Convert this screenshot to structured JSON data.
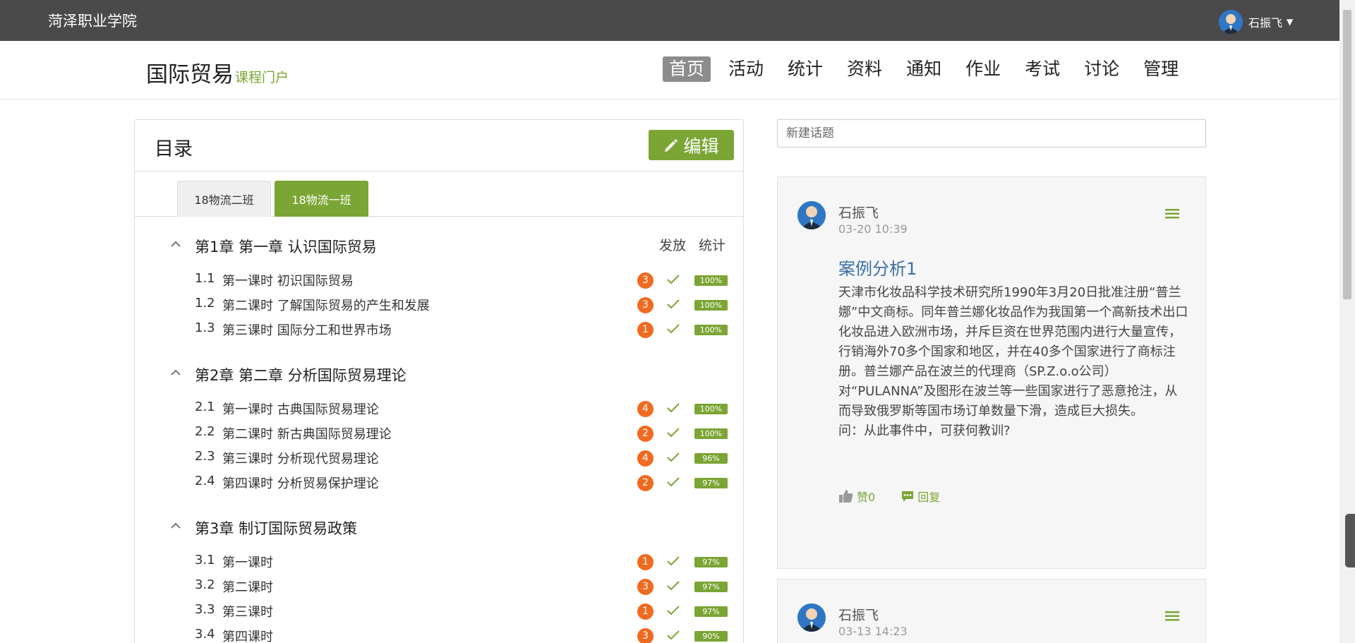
{
  "topbar": {
    "school": "菏泽职业学院",
    "user_name": "石振飞"
  },
  "header": {
    "course_title": "国际贸易",
    "course_subtitle": "课程门户",
    "menu": [
      {
        "label": "首页",
        "active": true
      },
      {
        "label": "活动"
      },
      {
        "label": "统计"
      },
      {
        "label": "资料"
      },
      {
        "label": "通知"
      },
      {
        "label": "作业"
      },
      {
        "label": "考试"
      },
      {
        "label": "讨论"
      },
      {
        "label": "管理"
      }
    ]
  },
  "catalog": {
    "title": "目录",
    "edit_label": "编辑",
    "tabs": [
      {
        "label": "18物流二班"
      },
      {
        "label": "18物流一班",
        "active": true
      }
    ],
    "col_release": "发放",
    "col_stats": "统计",
    "chapters": [
      {
        "title": "第1章 第一章 认识国际贸易",
        "lessons": [
          {
            "num": "1.1",
            "title": "第一课时 初识国际贸易",
            "badge": "3",
            "pct": "100%"
          },
          {
            "num": "1.2",
            "title": "第二课时 了解国际贸易的产生和发展",
            "badge": "3",
            "pct": "100%"
          },
          {
            "num": "1.3",
            "title": "第三课时 国际分工和世界市场",
            "badge": "1",
            "pct": "100%"
          }
        ]
      },
      {
        "title": "第2章 第二章 分析国际贸易理论",
        "lessons": [
          {
            "num": "2.1",
            "title": "第一课时 古典国际贸易理论",
            "badge": "4",
            "pct": "100%"
          },
          {
            "num": "2.2",
            "title": "第二课时 新古典国际贸易理论",
            "badge": "2",
            "pct": "100%"
          },
          {
            "num": "2.3",
            "title": "第三课时 分析现代贸易理论",
            "badge": "4",
            "pct": "96%"
          },
          {
            "num": "2.4",
            "title": "第四课时 分析贸易保护理论",
            "badge": "2",
            "pct": "97%"
          }
        ]
      },
      {
        "title": "第3章 制订国际贸易政策",
        "lessons": [
          {
            "num": "3.1",
            "title": "第一课时",
            "badge": "1",
            "pct": "97%"
          },
          {
            "num": "3.2",
            "title": "第二课时",
            "badge": "3",
            "pct": "97%"
          },
          {
            "num": "3.3",
            "title": "第三课时",
            "badge": "1",
            "pct": "97%"
          },
          {
            "num": "3.4",
            "title": "第四课时",
            "badge": "3",
            "pct": "90%"
          }
        ]
      }
    ]
  },
  "forum": {
    "new_topic_placeholder": "新建话题",
    "posts": [
      {
        "author": "石振飞",
        "time": "03-20 10:39",
        "title": "案例分析1",
        "body": "天津市化妆品科学技术研究所1990年3月20日批准注册“普兰娜”中文商标。同年普兰娜化妆品作为我国第一个高新技术出口化妆品进入欧洲市场，并斥巨资在世界范围内进行大量宣传，行销海外70多个国家和地区，并在40多个国家进行了商标注册。普兰娜产品在波兰的代理商（SP.Z.o.o公司）对“PULANNA”及图形在波兰等一些国家进行了恶意抢注，从而导致俄罗斯等国市场订单数量下滑，造成巨大损失。",
        "question": "问：从此事件中，可获何教训?",
        "like_label": "赞0",
        "reply_label": "回复"
      },
      {
        "author": "石振飞",
        "time": "03-13 14:23"
      }
    ]
  },
  "colors": {
    "accent": "#7ba534",
    "badge": "#f06a1f",
    "topbar": "#4a4a4a",
    "post_title": "#3a6ea5"
  }
}
